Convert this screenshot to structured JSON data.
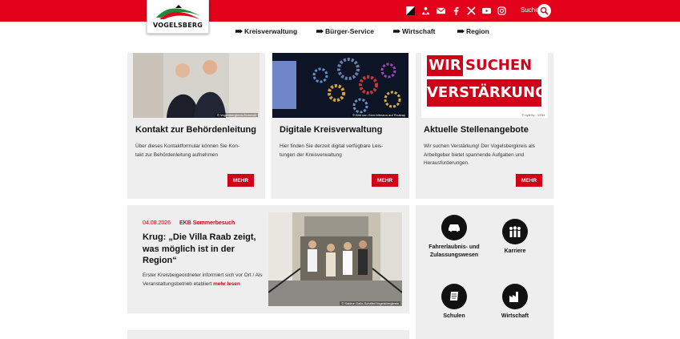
{
  "header": {
    "logo_text": "VOGELSBERG",
    "search_label": "Suche",
    "social_icons": [
      "sign-language-icon",
      "easy-language-icon",
      "mail-icon",
      "facebook-icon",
      "x-icon",
      "youtube-icon",
      "instagram-icon"
    ],
    "nav": [
      {
        "label": "Kreisverwaltung"
      },
      {
        "label": "Bürger-Service"
      },
      {
        "label": "Wirtschaft"
      },
      {
        "label": "Region"
      }
    ]
  },
  "cards": [
    {
      "title": "Kontakt zur Behördenleitung",
      "text": "Über dieses Kontaktformular können Sie Kon-\ntakt zur Behördenleitung aufnehmen",
      "button": "MEHR",
      "credit": "© Vogelsbergkreis/Hobelstil"
    },
    {
      "title": "Digitale Kreisverwaltung",
      "text": "Hier finden Sie derzeit digital verfügbare Leis-\ntungen der Kreisverwaltung",
      "button": "MEHR",
      "credit": "© Bild von Gerd Altmann auf Pixabay"
    },
    {
      "title": "Aktuelle Stellenangebote",
      "text": "Wir suchen Verstärkung! Der Vogelsbergkreis als\nArbeitgeber bietet spannende Aufgaben und\nHerausforderungen.",
      "button": "MEHR",
      "credit": "© nyft+fy - 123rf",
      "banner_line1": "WIR SUCHEN",
      "banner_line2": "VERSTÄRKUNG"
    }
  ],
  "news": {
    "date": "04.08.2026",
    "tag": "EKB Sommerbesuch",
    "title": "Krug: „Die Villa Raab zeigt, was möglich ist in der Region“",
    "text": "Erster Kreisbeigeordneter informiert sich vor Ort / Als Veranstaltungsbetrieb etabliert ",
    "more": "mehr lesen",
    "credit": "© Sabine Galle-Schäfer/Vogelsbergkreis"
  },
  "services": [
    {
      "label": "Fahrerlaubnis- und\nZulassungswesen",
      "icon": "car-icon"
    },
    {
      "label": "Karriere",
      "icon": "people-icon"
    },
    {
      "label": "Schulen",
      "icon": "book-icon"
    },
    {
      "label": "Wirtschaft",
      "icon": "factory-icon"
    }
  ],
  "colors": {
    "brand": "#e2001a",
    "card_bg": "#eeeeee",
    "button": "#d10019"
  }
}
